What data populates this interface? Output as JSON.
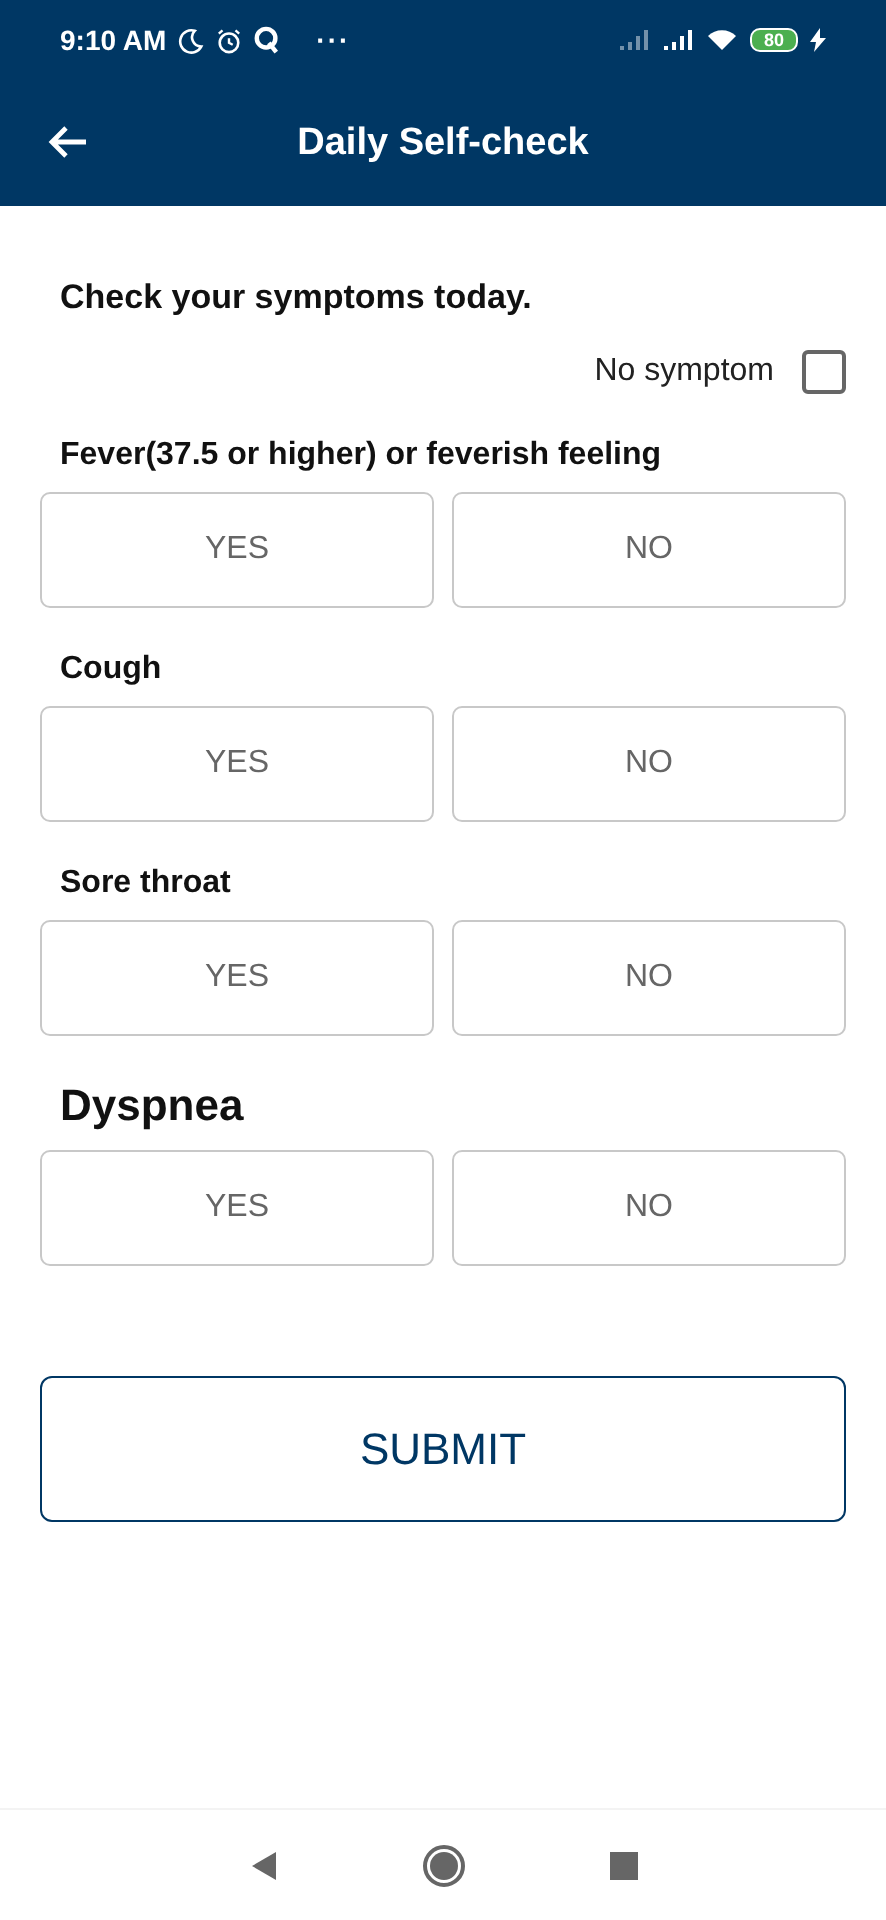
{
  "status_bar": {
    "time": "9:10 AM",
    "more": "···",
    "battery": "80"
  },
  "header": {
    "title": "Daily Self-check"
  },
  "prompt": "Check your symptoms today.",
  "no_symptom": {
    "label": "No symptom",
    "checked": false
  },
  "questions": [
    {
      "label": "Fever(37.5 or higher) or feverish feeling",
      "kind": "normal",
      "options": [
        {
          "label": "YES",
          "selected": false
        },
        {
          "label": "NO",
          "selected": false
        }
      ]
    },
    {
      "label": "Cough",
      "kind": "normal",
      "options": [
        {
          "label": "YES",
          "selected": false
        },
        {
          "label": "NO",
          "selected": false
        }
      ]
    },
    {
      "label": "Sore throat",
      "kind": "normal",
      "options": [
        {
          "label": "YES",
          "selected": false
        },
        {
          "label": "NO",
          "selected": false
        }
      ]
    },
    {
      "label": "Dyspnea",
      "kind": "large",
      "options": [
        {
          "label": "YES",
          "selected": false
        },
        {
          "label": "NO",
          "selected": false
        }
      ]
    }
  ],
  "submit": "SUBMIT"
}
